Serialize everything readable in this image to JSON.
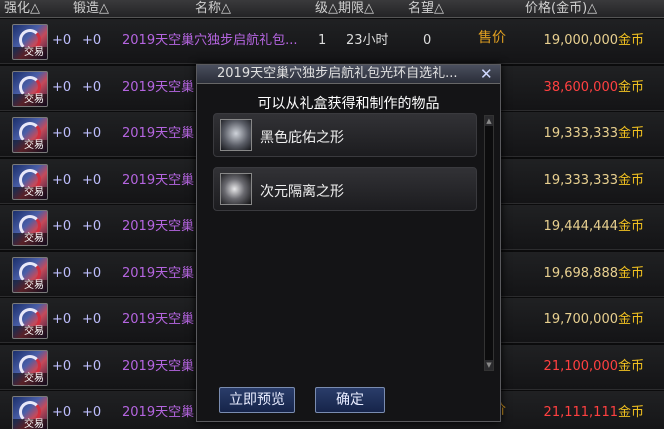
{
  "header": {
    "enhance": "强化△",
    "forge": "锻造△",
    "name": "名称△",
    "level_dur": "级△期限△",
    "fame": "名望△",
    "price": "价格(金币)△"
  },
  "rows": [
    {
      "plus1": "+0",
      "plus2": "+0",
      "name": "2019天空巢穴独步启航礼包...",
      "level": "1",
      "duration": "23小时",
      "fame": "0",
      "sale": "售价",
      "price": "19,000,000",
      "unit": "金币",
      "price_color": "normal"
    },
    {
      "plus1": "+0",
      "plus2": "+0",
      "name": "2019天空巢",
      "level": "",
      "duration": "",
      "fame": "",
      "sale": "",
      "price": "38,600,000",
      "unit": "金币",
      "price_color": "red"
    },
    {
      "plus1": "+0",
      "plus2": "+0",
      "name": "2019天空巢",
      "level": "",
      "duration": "",
      "fame": "",
      "sale": "价",
      "price": "19,333,333",
      "unit": "金币",
      "price_color": "normal"
    },
    {
      "plus1": "+0",
      "plus2": "+0",
      "name": "2019天空巢",
      "level": "",
      "duration": "",
      "fame": "",
      "sale": "",
      "price": "19,333,333",
      "unit": "金币",
      "price_color": "normal"
    },
    {
      "plus1": "+0",
      "plus2": "+0",
      "name": "2019天空巢",
      "level": "",
      "duration": "",
      "fame": "",
      "sale": "价",
      "price": "19,444,444",
      "unit": "金币",
      "price_color": "normal"
    },
    {
      "plus1": "+0",
      "plus2": "+0",
      "name": "2019天空巢",
      "level": "",
      "duration": "",
      "fame": "",
      "sale": "价",
      "price": "19,698,888",
      "unit": "金币",
      "price_color": "normal"
    },
    {
      "plus1": "+0",
      "plus2": "+0",
      "name": "2019天空巢",
      "level": "",
      "duration": "",
      "fame": "",
      "sale": "价",
      "price": "19,700,000",
      "unit": "金币",
      "price_color": "normal"
    },
    {
      "plus1": "+0",
      "plus2": "+0",
      "name": "2019天空巢",
      "level": "",
      "duration": "",
      "fame": "",
      "sale": "",
      "price": "21,100,000",
      "unit": "金币",
      "price_color": "red"
    },
    {
      "plus1": "+0",
      "plus2": "+0",
      "name": "2019天空巢",
      "level": "",
      "duration": "",
      "fame": "0",
      "sale": "售价",
      "price": "21,111,111",
      "unit": "金币",
      "price_color": "red"
    }
  ],
  "trade_label": "交易",
  "popup": {
    "title": "2019天空巢穴独步启航礼包光环自选礼...",
    "close": "✕",
    "subtitle": "可以从礼盒获得和制作的物品",
    "items": [
      {
        "name": "黑色庇佑之形"
      },
      {
        "name": "次元隔离之形"
      }
    ],
    "preview_button": "立即预览",
    "ok_button": "确定"
  }
}
